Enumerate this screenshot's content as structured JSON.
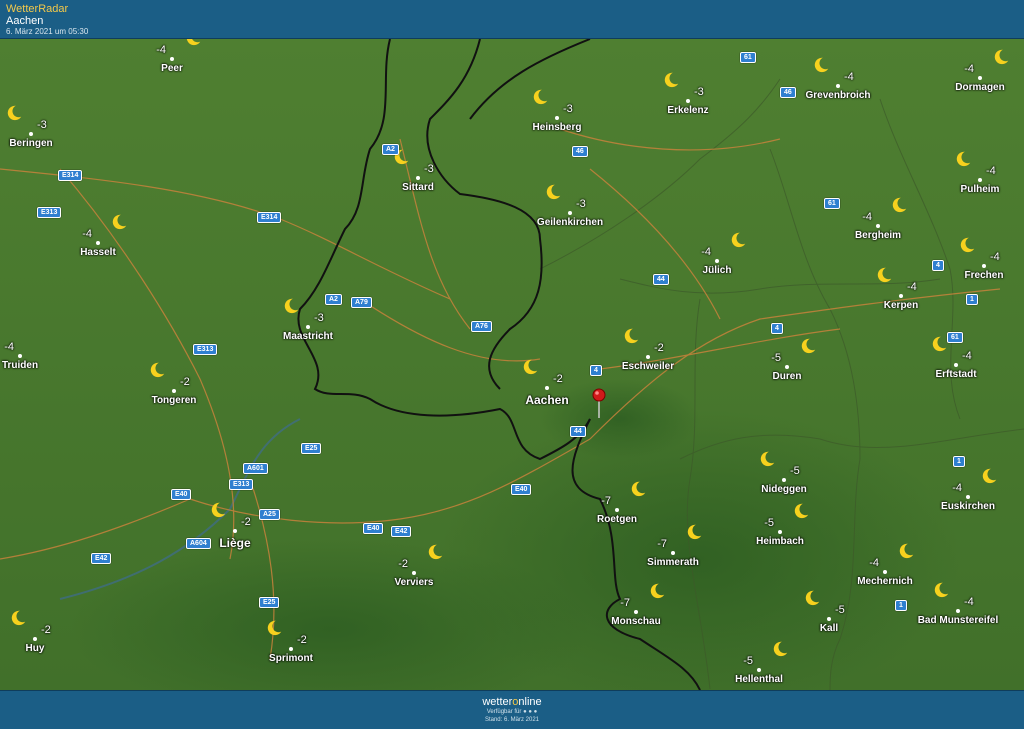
{
  "header": {
    "title": "WetterRadar",
    "place": "Aachen",
    "date": "6. März 2021 um 05:30"
  },
  "footer": {
    "brand_a": "wetter",
    "brand_o": "o",
    "brand_b": "nline",
    "available": "Verfügbar für",
    "stand": "Stand: 6. März 2021"
  },
  "colors": {
    "bar": "#1b5e86",
    "terrain": "#4a7a2e",
    "moon": "#f7d11e",
    "shield": "#2f7fd0"
  },
  "icon": "crescent-moon-icon",
  "cities": [
    {
      "name": "Peer",
      "temp": "-4"
    },
    {
      "name": "Beringen",
      "temp": "-3"
    },
    {
      "name": "Hasselt",
      "temp": "-4"
    },
    {
      "name": "Truiden",
      "temp": "-4"
    },
    {
      "name": "Tongeren",
      "temp": "-2"
    },
    {
      "name": "Liège",
      "temp": "-2"
    },
    {
      "name": "Huy",
      "temp": "-2"
    },
    {
      "name": "Sprimont",
      "temp": "-2"
    },
    {
      "name": "Verviers",
      "temp": "-2"
    },
    {
      "name": "Maastricht",
      "temp": "-3"
    },
    {
      "name": "Sittard",
      "temp": "-3"
    },
    {
      "name": "Heinsberg",
      "temp": "-3"
    },
    {
      "name": "Erkelenz",
      "temp": "-3"
    },
    {
      "name": "Geilenkirchen",
      "temp": "-3"
    },
    {
      "name": "Aachen",
      "temp": "-2"
    },
    {
      "name": "Eschweiler",
      "temp": "-2"
    },
    {
      "name": "Jülich",
      "temp": "-4"
    },
    {
      "name": "Grevenbroich",
      "temp": "-4"
    },
    {
      "name": "Dormagen",
      "temp": "-4"
    },
    {
      "name": "Pulheim",
      "temp": "-4"
    },
    {
      "name": "Bergheim",
      "temp": "-4"
    },
    {
      "name": "Frechen",
      "temp": "-4"
    },
    {
      "name": "Kerpen",
      "temp": "-4"
    },
    {
      "name": "Duren",
      "temp": "-5"
    },
    {
      "name": "Erftstadt",
      "temp": "-4"
    },
    {
      "name": "Roetgen",
      "temp": "-7"
    },
    {
      "name": "Simmerath",
      "temp": "-7"
    },
    {
      "name": "Monschau",
      "temp": "-7"
    },
    {
      "name": "Nideggen",
      "temp": "-5"
    },
    {
      "name": "Heimbach",
      "temp": "-5"
    },
    {
      "name": "Kall",
      "temp": "-5"
    },
    {
      "name": "Hellenthal",
      "temp": "-5"
    },
    {
      "name": "Mechernich",
      "temp": "-4"
    },
    {
      "name": "Euskirchen",
      "temp": "-4"
    },
    {
      "name": "Bad Munstereifel",
      "temp": "-4"
    }
  ],
  "road_labels": [
    "E314",
    "E313",
    "E314",
    "A2",
    "A2",
    "A79",
    "A76",
    "E313",
    "E25",
    "A601",
    "E313",
    "E40",
    "A25",
    "A604",
    "E42",
    "E25",
    "E40",
    "E42",
    "E40",
    "4",
    "44",
    "44",
    "46",
    "61",
    "46",
    "61",
    "4",
    "4",
    "1",
    "61",
    "1",
    "1"
  ]
}
